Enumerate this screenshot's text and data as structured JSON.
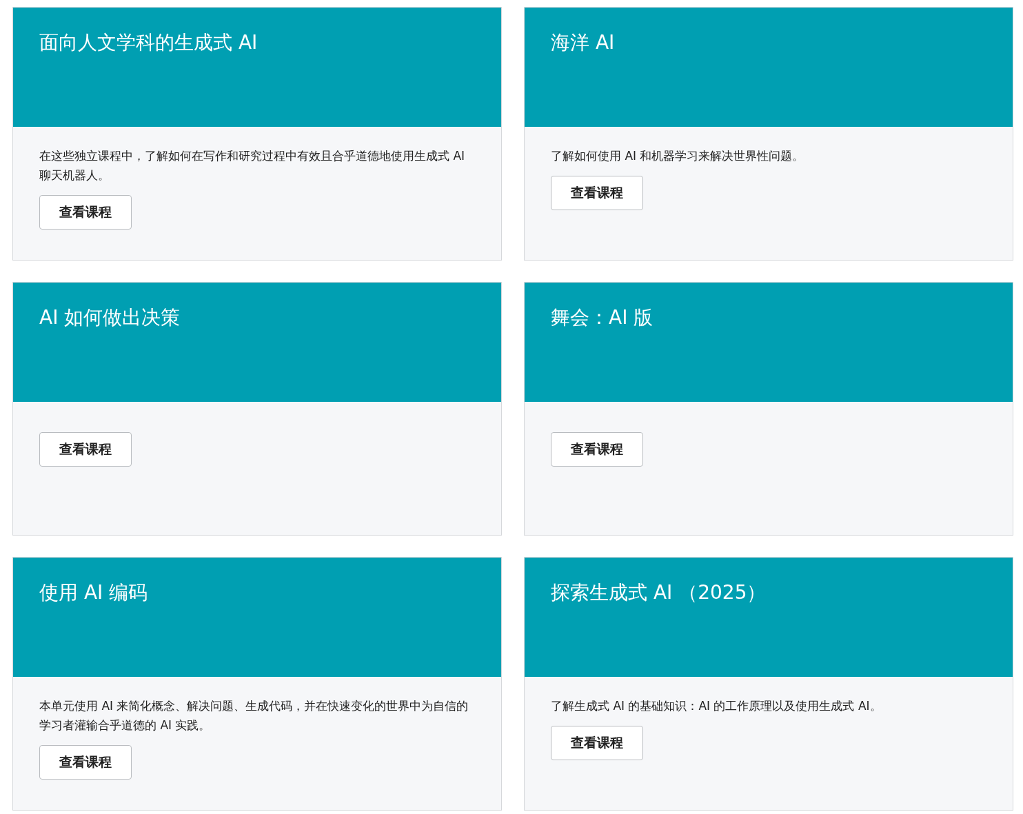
{
  "courses": [
    {
      "title": "面向人文学科的生成式 AI",
      "description": "在这些独立课程中，了解如何在写作和研究过程中有效且合乎道德地使用生成式 AI 聊天机器人。",
      "button": "查看课程"
    },
    {
      "title": "海洋 AI",
      "description": "了解如何使用 AI 和机器学习来解决世界性问题。",
      "button": "查看课程"
    },
    {
      "title": "AI 如何做出决策",
      "button": "查看课程"
    },
    {
      "title": "舞会：AI 版",
      "button": "查看课程"
    },
    {
      "title": "使用 AI 编码",
      "description": "本单元使用 AI 来简化概念、解决问题、生成代码，并在快速变化的世界中为自信的学习者灌输合乎道德的 AI 实践。",
      "button": "查看课程"
    },
    {
      "title": "探索生成式 AI （2025）",
      "description": "了解生成式 AI 的基础知识：AI 的工作原理以及使用生成式 AI。",
      "button": "查看课程"
    }
  ]
}
